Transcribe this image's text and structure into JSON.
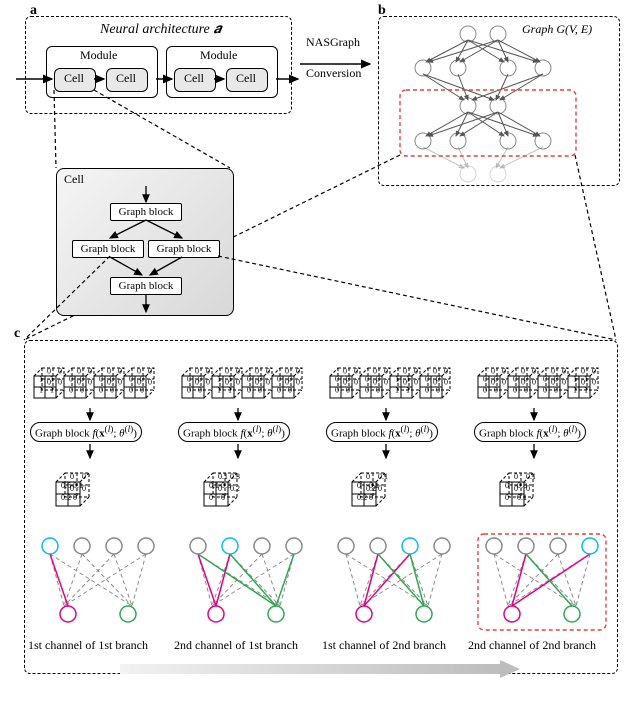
{
  "a": {
    "tag": "a",
    "title": "Neural architecture 𝒂",
    "moduleLabel": "Module",
    "cellLabel": "Cell",
    "conversion": [
      "NASGraph",
      "Conversion"
    ]
  },
  "b": {
    "tag": "b",
    "graphLabel": "Graph G(V, E)"
  },
  "cell": {
    "title": "Cell",
    "block": "Graph block"
  },
  "c": {
    "tag": "c",
    "gbf": "Graph block f(𝐱⁽ˡ⁾; θ⁽ˡ⁾)",
    "captions": [
      "1st channel of 1st branch",
      "2nd channel of 1st branch",
      "1st channel of 2nd branch",
      "2nd channel of 2nd branch"
    ],
    "inputs": [
      {
        "cyanIdx": 0,
        "cyan": [
          [
            "1",
            "1"
          ],
          [
            "1",
            "1"
          ]
        ],
        "others": [
          [
            "0",
            "0",
            "0",
            "0"
          ],
          [
            "0",
            "0",
            "0",
            "0"
          ],
          [
            "0",
            "0",
            "0",
            "0"
          ]
        ]
      },
      {
        "cyanIdx": 1,
        "cyan": [
          [
            "1",
            "1"
          ],
          [
            "1",
            "1"
          ]
        ],
        "others": [
          [
            "0",
            "0",
            "0",
            "0"
          ],
          [
            "0",
            "0",
            "0",
            "0"
          ],
          [
            "0",
            "0",
            "0",
            "0"
          ]
        ]
      },
      {
        "cyanIdx": 2,
        "cyan": [
          [
            "1",
            "1"
          ],
          [
            "1",
            "1"
          ]
        ],
        "others": [
          [
            "0",
            "0",
            "0",
            "0"
          ],
          [
            "0",
            "0",
            "0",
            "0"
          ],
          [
            "0",
            "0",
            "0",
            "0"
          ]
        ]
      },
      {
        "cyanIdx": 3,
        "cyan": [
          [
            "1",
            "1"
          ],
          [
            "1",
            "1"
          ]
        ],
        "others": [
          [
            "0",
            "0",
            "0",
            "0"
          ],
          [
            "0",
            "0",
            "0",
            "0"
          ],
          [
            "0",
            "0",
            "0",
            "0"
          ]
        ]
      }
    ],
    "outputs": [
      {
        "pink": [
          [
            "0.6",
            "0.1"
          ],
          [
            "0.2",
            "0"
          ]
        ],
        "green": [
          [
            "0",
            "0"
          ],
          [
            "0",
            "0"
          ]
        ]
      },
      {
        "pink": [
          [
            "0.1",
            "0.3"
          ],
          [
            "0",
            "0"
          ]
        ],
        "green": [
          [
            "0.1",
            "0.3"
          ],
          [
            "0",
            "0.2"
          ]
        ]
      },
      {
        "pink": [
          [
            "0",
            "0.1"
          ],
          [
            "0.2",
            "0"
          ]
        ],
        "green": [
          [
            "0",
            "0.1"
          ],
          [
            "0.2",
            "0"
          ]
        ]
      },
      {
        "pink": [
          [
            "0",
            "0.8"
          ],
          [
            "0",
            "0.1"
          ]
        ],
        "green": [
          [
            "0",
            "0.1"
          ],
          [
            "0",
            "0"
          ]
        ]
      }
    ],
    "bipartite": [
      {
        "cyan": 0,
        "pink": 0,
        "green": 1,
        "pinkEdges": [
          0
        ],
        "greenEdges": []
      },
      {
        "cyan": 1,
        "pink": 0,
        "green": 1,
        "pinkEdges": [
          0,
          1
        ],
        "greenEdges": [
          0,
          1,
          3
        ]
      },
      {
        "cyan": 2,
        "pink": 0,
        "green": 1,
        "pinkEdges": [
          1,
          2
        ],
        "greenEdges": [
          1,
          2
        ]
      },
      {
        "cyan": 3,
        "pink": 0,
        "green": 1,
        "pinkEdges": [
          1,
          3
        ],
        "greenEdges": [
          1
        ]
      }
    ]
  },
  "colors": {
    "cyan": "#00bfe6",
    "pink": "#e6007e",
    "green": "#2fa84f",
    "red": "#e74040"
  }
}
